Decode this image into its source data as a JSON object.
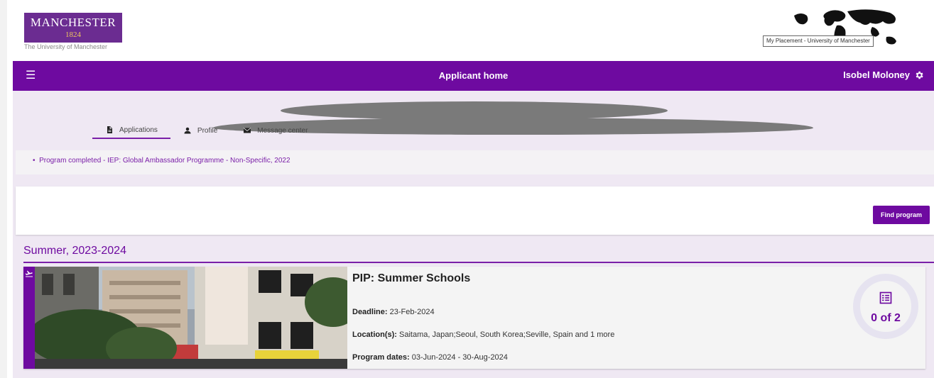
{
  "brand": {
    "logo_name": "MANCHESTER",
    "logo_year": "1824",
    "logo_sub": "The University of Manchester",
    "placement_label": "My Placement - University of Manchester"
  },
  "navbar": {
    "title": "Applicant home",
    "user_name": "Isobel Moloney",
    "menu_icon": "hamburger-icon",
    "settings_icon": "gear-icon",
    "color": "#6e0aa0"
  },
  "tabs": [
    {
      "label": "Applications",
      "icon": "document-icon",
      "active": true
    },
    {
      "label": "Profile",
      "icon": "person-icon",
      "active": false
    },
    {
      "label": "Message center",
      "icon": "envelope-icon",
      "active": false
    }
  ],
  "completed": {
    "item": "Program completed - IEP: Global Ambassador Programme - Non-Specific, 2022"
  },
  "find_program": {
    "label": "Find program"
  },
  "season": {
    "heading": "Summer, 2023-2024"
  },
  "program": {
    "title": "PIP: Summer Schools",
    "deadline_label": "Deadline:",
    "deadline_value": "23-Feb-2024",
    "location_label": "Location(s):",
    "location_value": "Saitama, Japan;Seoul, South Korea;Seville, Spain and 1 more",
    "dates_label": "Program dates:",
    "dates_value": "03-Jun-2024 - 30-Aug-2024",
    "progress_text": "0 of 2",
    "progress_icon": "list-icon",
    "type_icon": "plane-icon"
  }
}
